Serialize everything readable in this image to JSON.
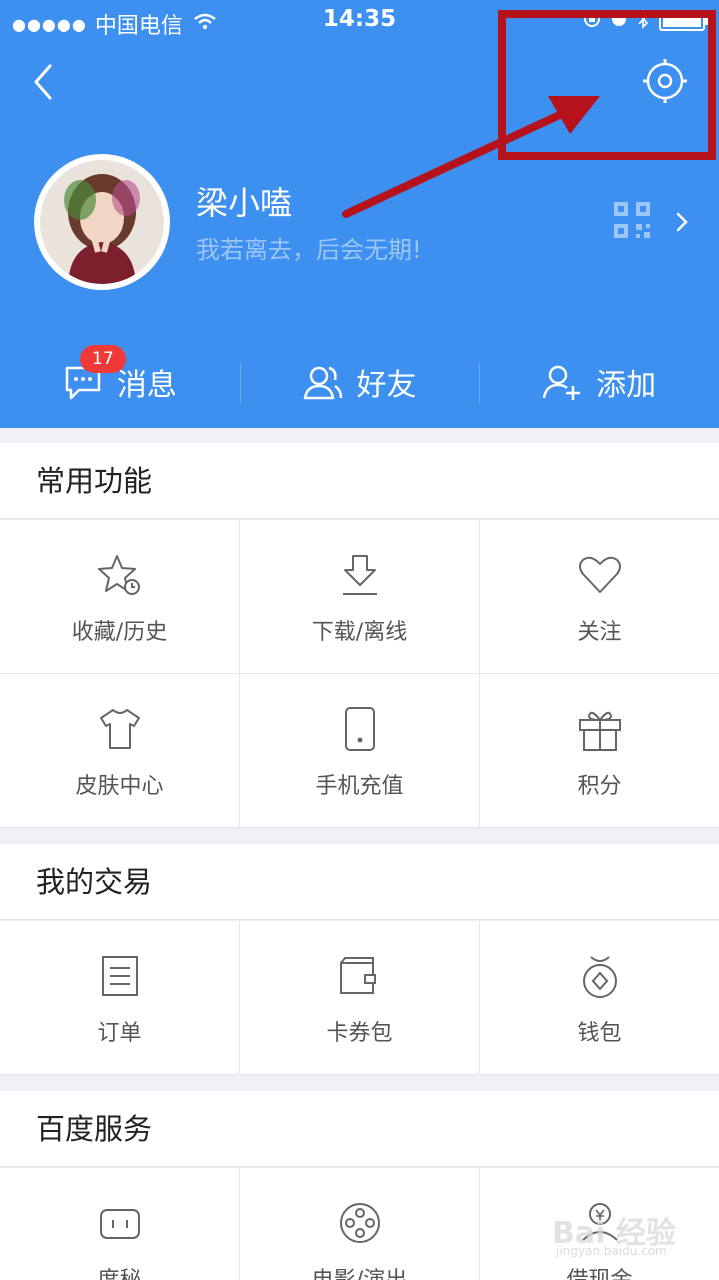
{
  "status_bar": {
    "carrier": "中国电信",
    "time": "14:35"
  },
  "profile": {
    "username": "梁小嗑",
    "signature": "我若离去，后会无期!"
  },
  "tabs": [
    {
      "label": "消息",
      "badge": "17"
    },
    {
      "label": "好友"
    },
    {
      "label": "添加"
    }
  ],
  "sections": {
    "common": {
      "title": "常用功能",
      "items": [
        {
          "label": "收藏/历史",
          "icon": "star-clock-icon"
        },
        {
          "label": "下载/离线",
          "icon": "download-icon"
        },
        {
          "label": "关注",
          "icon": "heart-icon"
        },
        {
          "label": "皮肤中心",
          "icon": "tshirt-icon"
        },
        {
          "label": "手机充值",
          "icon": "phone-icon"
        },
        {
          "label": "积分",
          "icon": "gift-icon"
        }
      ]
    },
    "trade": {
      "title": "我的交易",
      "items": [
        {
          "label": "订单",
          "icon": "document-icon"
        },
        {
          "label": "卡券包",
          "icon": "wallet-icon"
        },
        {
          "label": "钱包",
          "icon": "money-bag-icon"
        }
      ]
    },
    "services": {
      "title": "百度服务",
      "items": [
        {
          "label": "度秘",
          "icon": "robot-icon"
        },
        {
          "label": "电影/演出",
          "icon": "film-reel-icon"
        },
        {
          "label": "借现金",
          "icon": "cash-icon"
        }
      ]
    }
  },
  "watermark": {
    "text": "Bai 经验",
    "sub": "jingyan.baidu.com"
  },
  "colors": {
    "header_bg": "#3d8ff0",
    "highlight": "#b5121b",
    "badge": "#f03a3a"
  }
}
